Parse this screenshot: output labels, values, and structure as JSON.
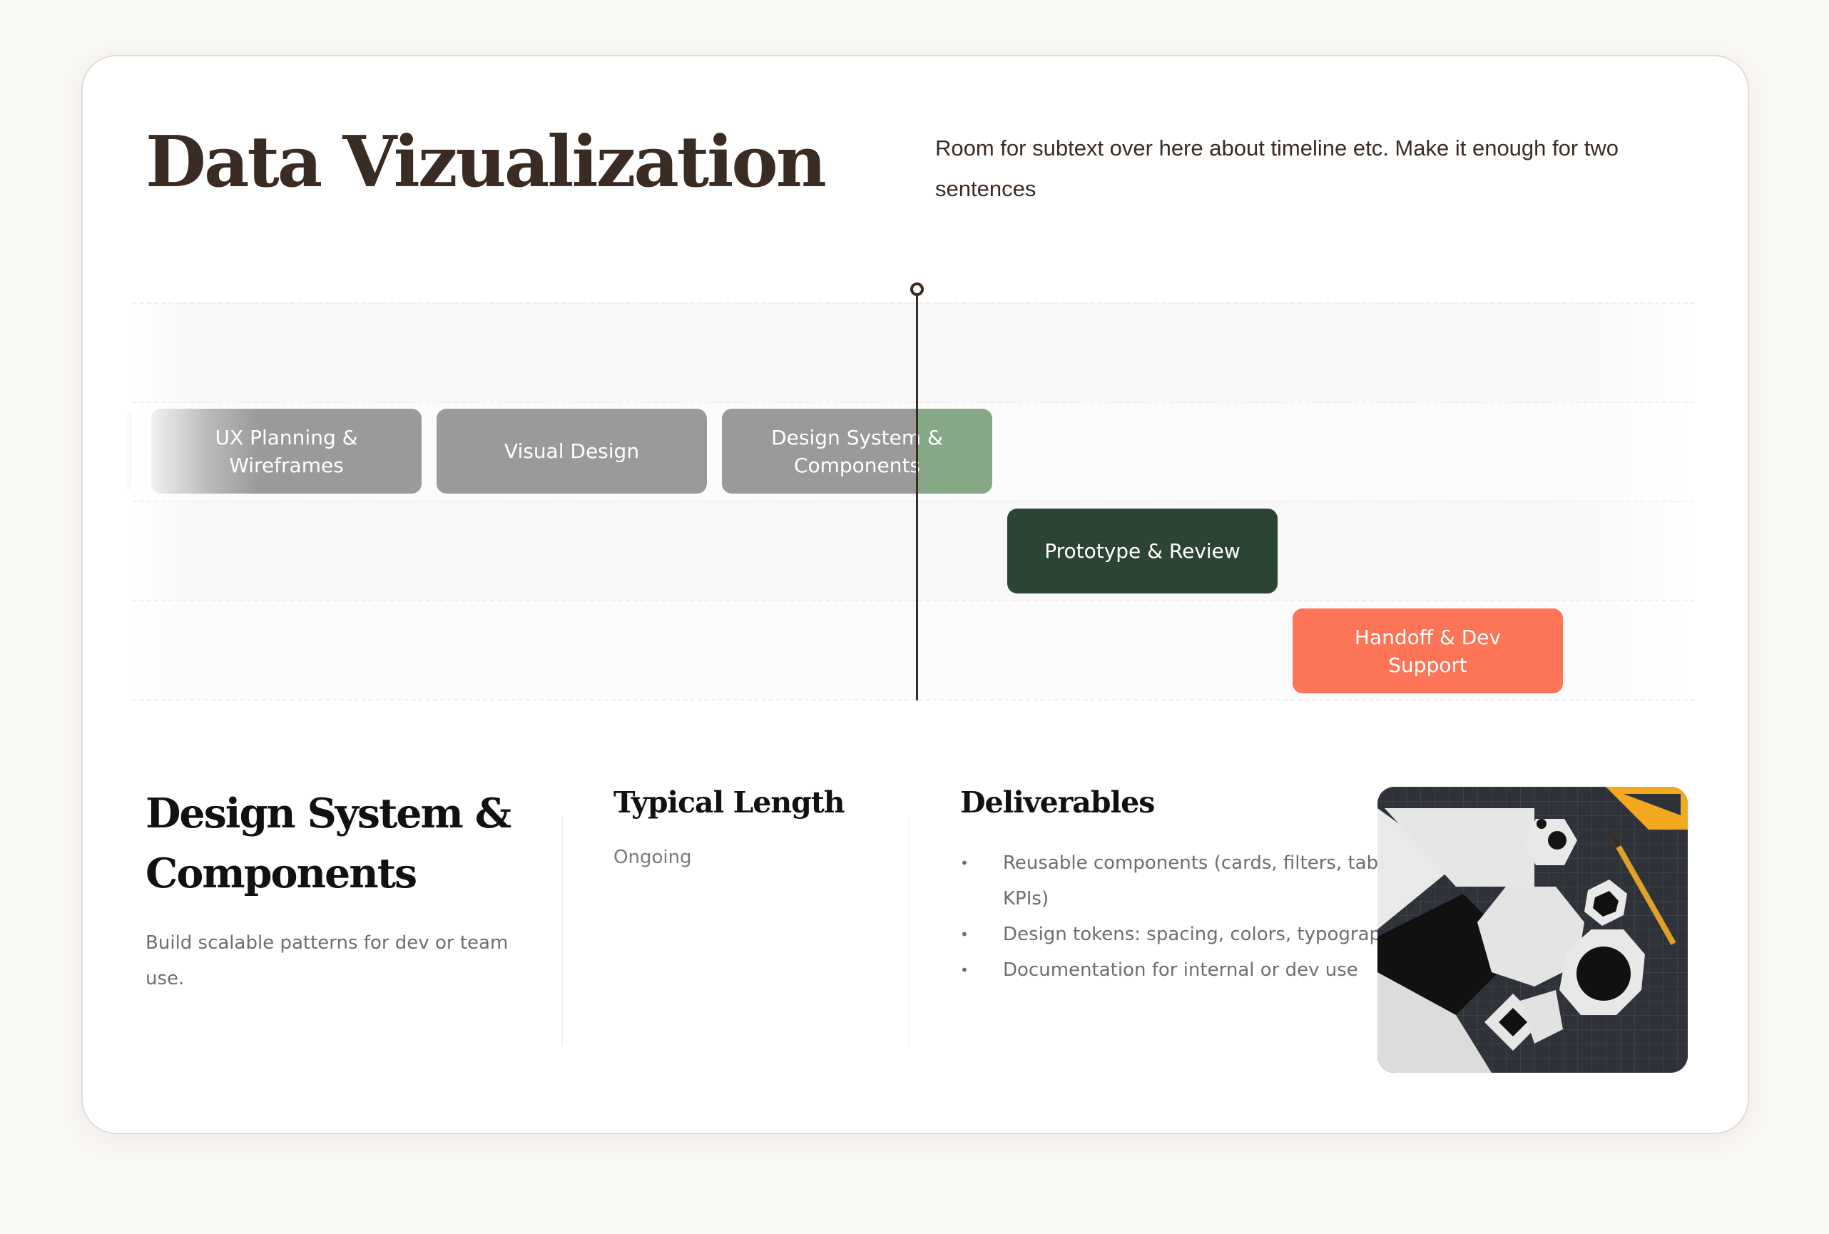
{
  "header": {
    "title": "Data Vizualization",
    "subtext": "Room for subtext over here about timeline etc. Make it enough for two sentences"
  },
  "timeline": {
    "phases": [
      {
        "label": "UX Planning & Wireframes",
        "color": "#9a9a9a"
      },
      {
        "label": "Visual Design",
        "color": "#9a9a9a"
      },
      {
        "label": "Design System & Components",
        "color": "#9a9a9a",
        "accent_color": "#86a887"
      },
      {
        "label": "Prototype & Review",
        "color": "#2c4433"
      },
      {
        "label": "Handoff & Dev Support",
        "color": "#fd7456"
      }
    ],
    "current_marker_color": "#3a2c23"
  },
  "detail": {
    "title": "Design System & Components",
    "description": "Build scalable patterns for dev or team use.",
    "typical_length_heading": "Typical Length",
    "typical_length_value": "Ongoing",
    "deliverables_heading": "Deliverables",
    "deliverables": [
      "Reusable components (cards, filters, tables, KPIs)",
      "Design tokens: spacing, colors, typography",
      "Documentation for internal or dev use"
    ],
    "bullet": "•",
    "image_name": "geometric-shapes-image"
  }
}
